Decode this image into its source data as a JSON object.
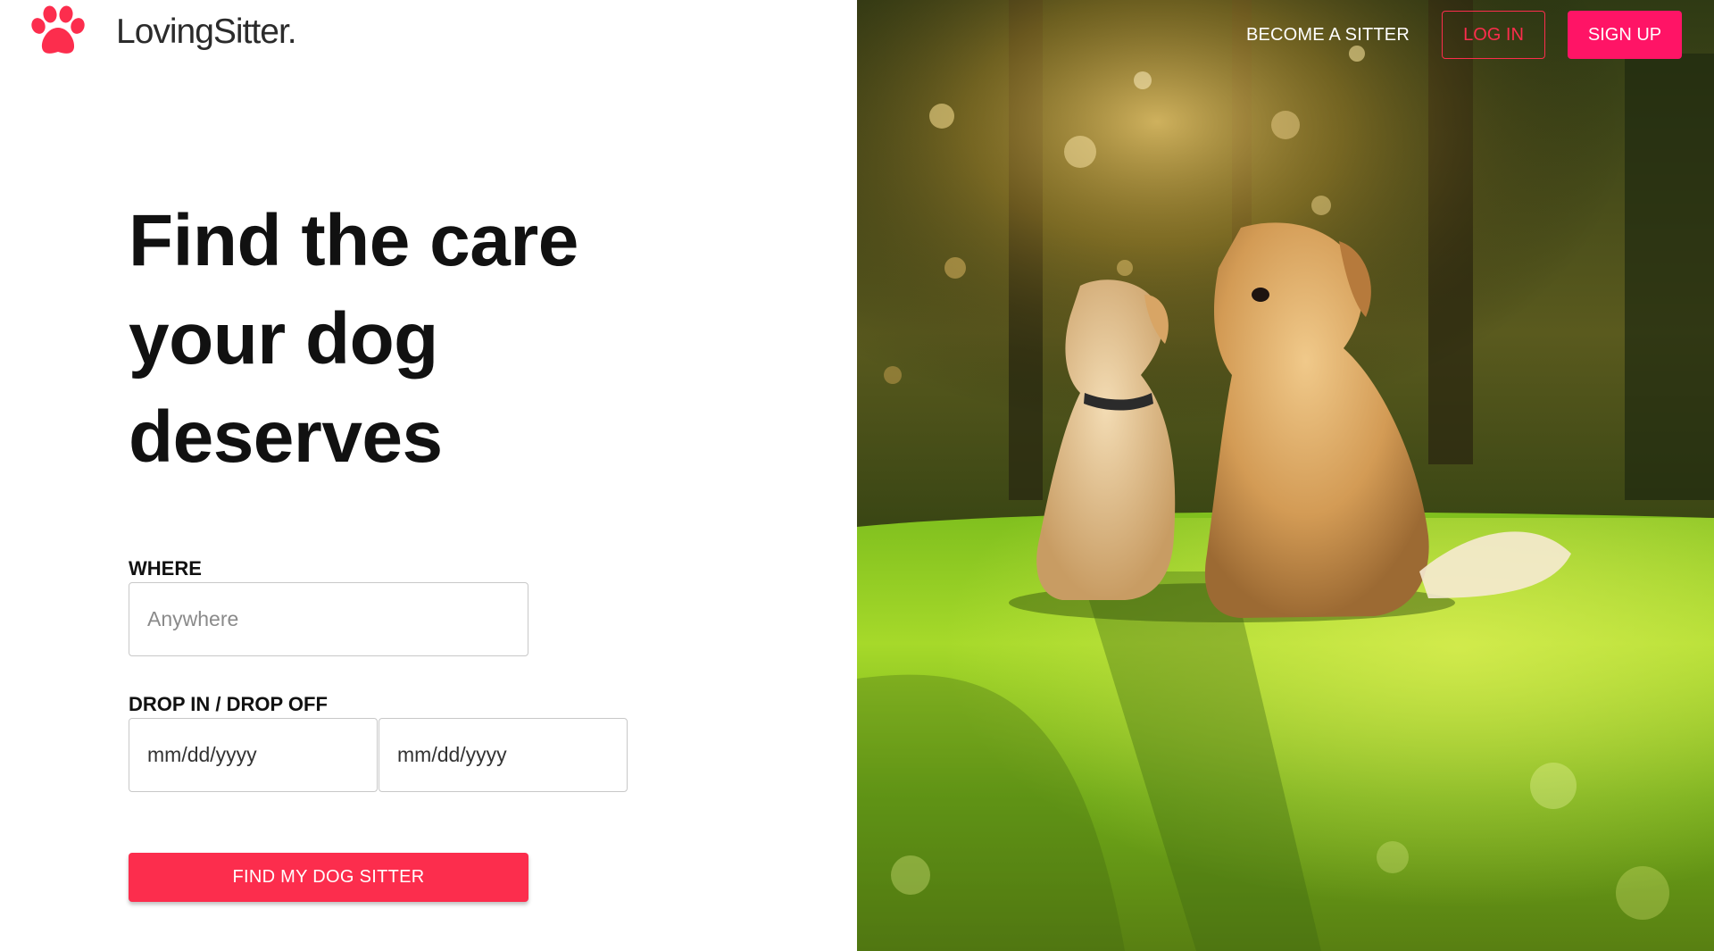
{
  "brand": {
    "name": "LovingSitter.",
    "accent_color": "#fc2d4d",
    "signup_color": "#ff1466",
    "logo_icon": "paw-icon"
  },
  "nav": {
    "become_sitter": "BECOME A SITTER",
    "login": "LOG IN",
    "signup": "SIGN UP"
  },
  "hero": {
    "headline": "Find the care your dog deserves",
    "photo_icon": "dogs-photo"
  },
  "search": {
    "where_label": "WHERE",
    "where_placeholder": "Anywhere",
    "dates_label": "DROP IN / DROP OFF",
    "drop_in_value": "mm/dd/yyyy",
    "drop_off_value": "mm/dd/yyyy",
    "submit_label": "FIND MY DOG SITTER"
  }
}
